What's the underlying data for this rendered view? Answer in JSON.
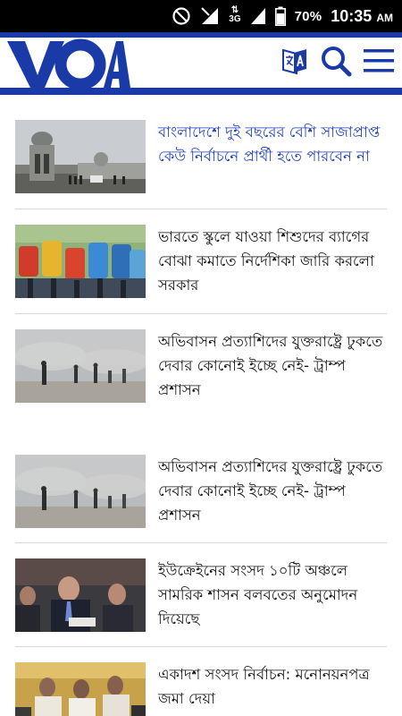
{
  "status_bar": {
    "battery": "70%",
    "time": "10:35",
    "ampm": "AM",
    "network": "3G",
    "icons": [
      "do-not-disturb-icon",
      "signal-icon",
      "network-3g-icon",
      "battery-icon"
    ]
  },
  "header": {
    "logo": "VOA",
    "icons": [
      "language-icon",
      "search-icon",
      "menu-icon"
    ],
    "accent_color": "#1a3aa8"
  },
  "feed": {
    "items": [
      {
        "headline": "বাংলাদেশে দুই বছরের বেশি সাজাপ্রাপ্ত কেউ নির্বাচনে প্রার্থী হতে পারবেন না",
        "active": true
      },
      {
        "headline": "ভারতে স্কুলে যাওয়া শিশুদের ব্যাগের বোঝা কমাতে নির্দেশিকা জারি করলো সরকার",
        "active": false
      },
      {
        "headline": "অভিবাসন প্রত্যাশিদের যুক্তরাষ্ট্রে ঢুকতে দেবার কোনোই ইচ্ছে নেই- ট্রাম্প প্রশাসন",
        "active": false
      },
      {
        "headline": "অভিবাসন প্রত্যাশিদের যুক্তরাষ্ট্রে ঢুকতে দেবার কোনোই ইচ্ছে নেই- ট্রাম্প প্রশাসন",
        "active": false
      },
      {
        "headline": "ইউক্রেইনের সংসদ ১০টি অঞ্চলে সামরিক শাসন বলবতের অনুমোদন দিয়েছে",
        "active": false
      },
      {
        "headline": "একাদশ সংসদ নির্বাচন: মনোনয়নপত্র জমা দেয়া",
        "active": false
      }
    ],
    "active_color": "#1e3fc0"
  }
}
